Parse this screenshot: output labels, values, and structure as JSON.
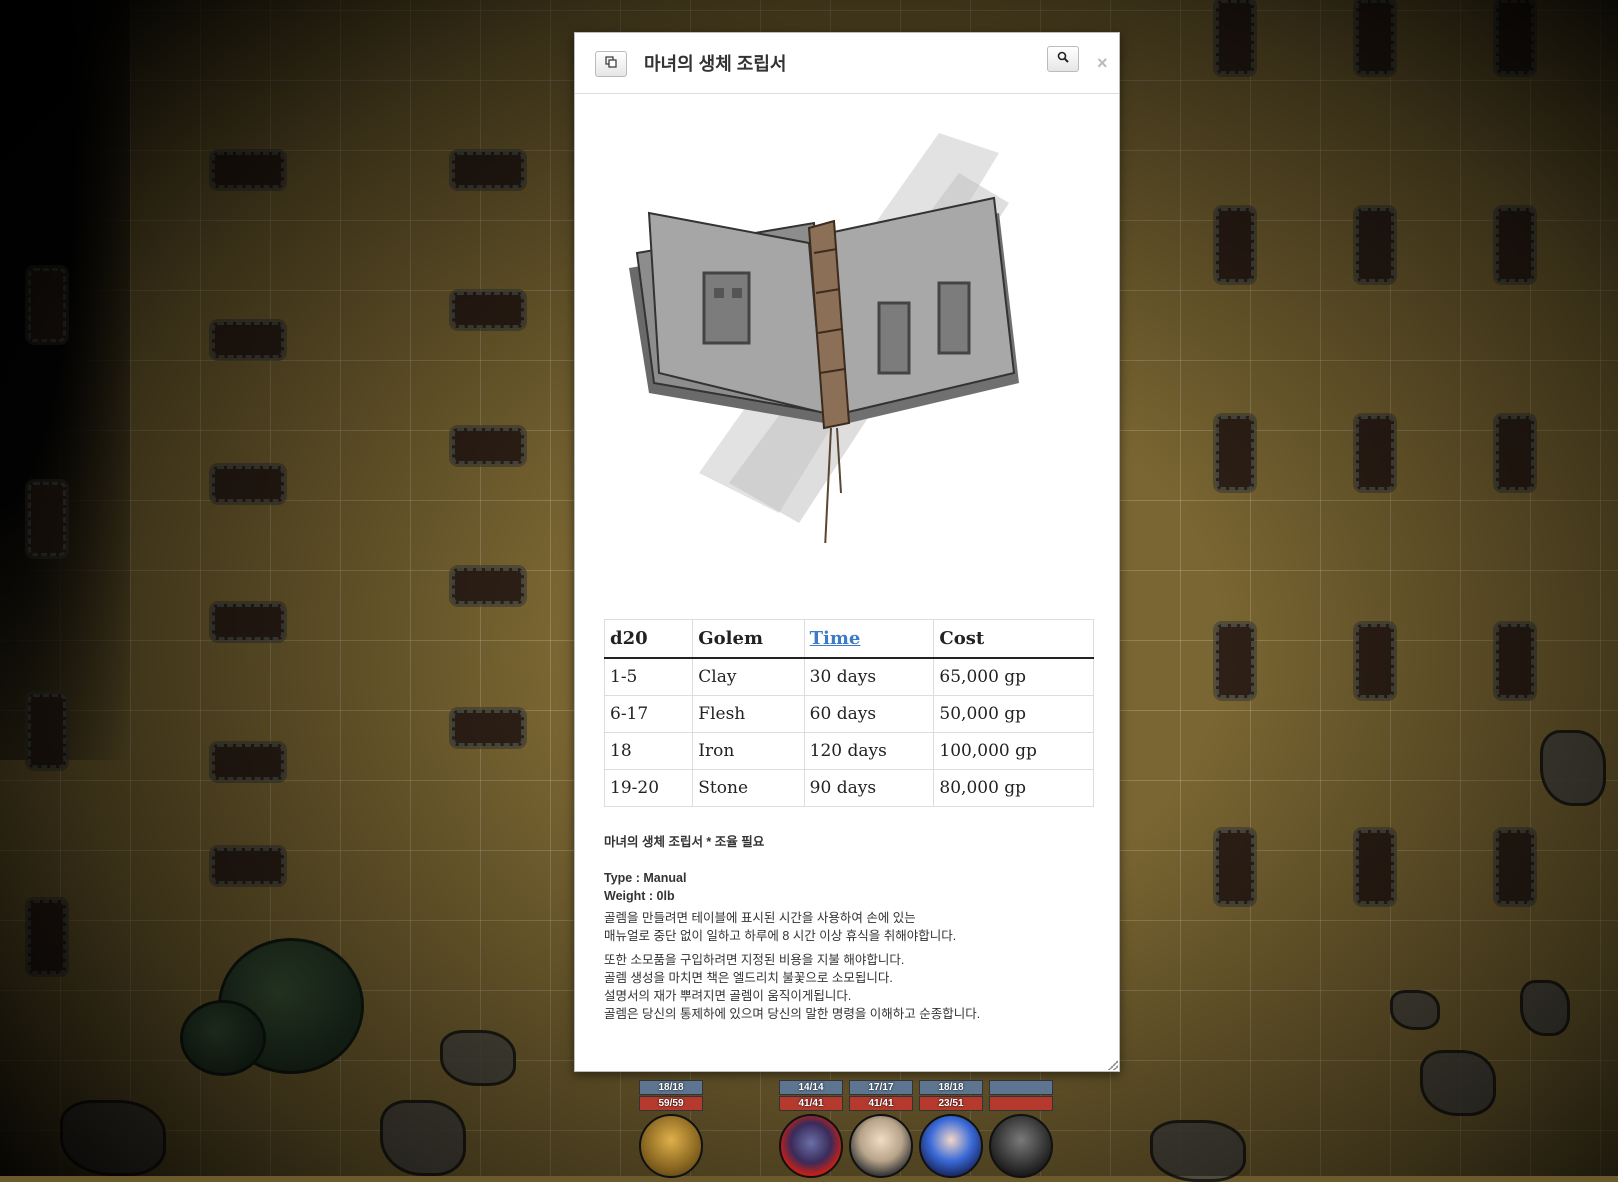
{
  "dialog": {
    "title": "마녀의 생체 조립서",
    "popout_icon": "popout-icon",
    "search_icon": "magnifier-icon",
    "close_label": "×"
  },
  "table": {
    "headers": [
      "d20",
      "Golem",
      "Time",
      "Cost"
    ],
    "rows": [
      [
        "1-5",
        "Clay",
        "30 days",
        "65,000 gp"
      ],
      [
        "6-17",
        "Flesh",
        "60 days",
        "50,000 gp"
      ],
      [
        "18",
        "Iron",
        "120 days",
        "100,000 gp"
      ],
      [
        "19-20",
        "Stone",
        "90 days",
        "80,000 gp"
      ]
    ]
  },
  "description": {
    "heading": "마녀의 생체 조립서 * 조율 필요",
    "type": "Type : Manual",
    "weight": "Weight : 0lb",
    "para1_line1": "골렘을 만들려면 테이블에 표시된 시간을 사용하여 손에 있는",
    "para1_line2": "매뉴얼로 중단 없이 일하고 하루에 8 시간 이상 휴식을 취해야합니다.",
    "para2_line1": "또한 소모품을 구입하려면 지정된 비용을 지불 해야합니다.",
    "para2_line2": "골렘 생성을 마치면 책은 엘드리치 불꽃으로 소모됩니다.",
    "para2_line3": "설명서의 재가 뿌려지면 골렘이 움직이게됩니다.",
    "para2_line4": "골렘은 당신의 통제하에 있으며 당신의 말한 명령을 이해하고 순종합니다."
  },
  "tokens": [
    {
      "bar1": "18/18",
      "bar2": "59/59",
      "color": "#c9962e"
    },
    {
      "bar1": "14/14",
      "bar2": "41/41",
      "color": "#b3211a"
    },
    {
      "bar1": "17/17",
      "bar2": "41/41",
      "color": "#8a8070"
    },
    {
      "bar1": "18/18",
      "bar2": "23/51",
      "color": "#2a55b8"
    },
    {
      "bar1": "",
      "bar2": "",
      "color": "#4a4a4a"
    }
  ]
}
